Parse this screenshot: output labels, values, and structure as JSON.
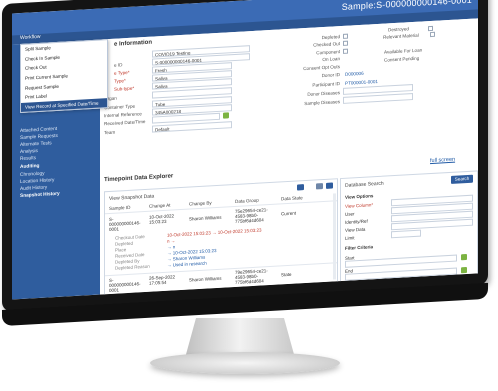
{
  "app": {
    "title": "Sample:S-000000000146-0001",
    "menu_label": "Workflow"
  },
  "workflow_menu": {
    "items": [
      "Split Sample",
      "Check In Sample",
      "Check Out",
      "Print Current Sample",
      "Request Sample",
      "Print Label",
      "View Record at Specified Date/Time"
    ],
    "active_index": 6
  },
  "sidebar": {
    "items": [
      "Attached Content",
      "Sample Requests",
      "Alternate Tests",
      "Analysis",
      "Results"
    ],
    "section": "Auditing",
    "audit_items": [
      "Chronology",
      "Location History",
      "Audit History",
      "Snapshot History"
    ]
  },
  "sample_info": {
    "heading": "e Information",
    "fields": [
      {
        "label": "",
        "value": "COVID19 Testing"
      },
      {
        "label": "e ID",
        "value": "S-000000000146-0001"
      },
      {
        "label": "e Type*",
        "value": "Fresh"
      },
      {
        "label": "Type*",
        "value": "Saliva"
      },
      {
        "label": "Sub-type*",
        "value": "Saliva"
      },
      {
        "label": "Organ",
        "value": ""
      },
      {
        "label": "Container Type",
        "value": "Tube"
      },
      {
        "label": "Internal Reference",
        "value": "345A000218"
      },
      {
        "label": "Received Date/Time",
        "value": ""
      },
      {
        "label": "Team",
        "value": "Default"
      }
    ],
    "right_labels": [
      "Depleted",
      "Checked Out",
      "Component",
      "On Loan",
      "Consent Opt Outs",
      "Donor ID",
      "Participant ID",
      "Donor Diseases",
      "Sample Diseases"
    ],
    "destroyed_label": "Destroyed",
    "relevant_material_label": "Relevant Material",
    "available_loan_label": "Available For Loan",
    "consent_pending_label": "Consent Pending",
    "donor_id": "D000006",
    "participant_id": "PT000001-0001"
  },
  "timepoint": {
    "heading": "Timepoint Data Explorer",
    "full_screen": "full screen",
    "sub_heading": "View Snapshot Data",
    "columns": [
      "Sample ID",
      "Change At",
      "Change By",
      "Data Group",
      "Data State"
    ],
    "rows": [
      {
        "sample_id": "S-000000000146-0001",
        "change_at": "10-Oct-2022 15:03:23",
        "change_by": "Sharon Williams",
        "data_group": "75e29654-ce21-4583-98b0-775bf6d4d604",
        "data_state": "Current",
        "details_labels": [
          "Checkout Date",
          "Depleted",
          "Place",
          "Received Date",
          "Depleted By",
          "Depleted Reason"
        ],
        "details_values": [
          "10-Oct-2022 15:03:23 → 10-Oct-2022 15:03:23",
          "n →",
          "→ n",
          "→ 10-Oct-2022 15:03:23",
          "→ Sharon Williams",
          "→ Used in research"
        ]
      },
      {
        "sample_id": "S-000000000146-0001",
        "change_at": "26-Sep-2022 17:05:54",
        "change_by": "Sharon Williams",
        "data_group": "79e29654-ce21-4583-98b0-775bf6d4d604",
        "data_state": "State"
      }
    ]
  },
  "database_search": {
    "heading": "Database Search",
    "search_button": "Search",
    "view_options": "View Options",
    "view_column_label": "View Column*",
    "fields": [
      "User",
      "Identity/Ref",
      "View Data",
      "Limit"
    ],
    "filter_criteria": "Filter Criteria",
    "range_labels": [
      "Start",
      "End"
    ]
  }
}
